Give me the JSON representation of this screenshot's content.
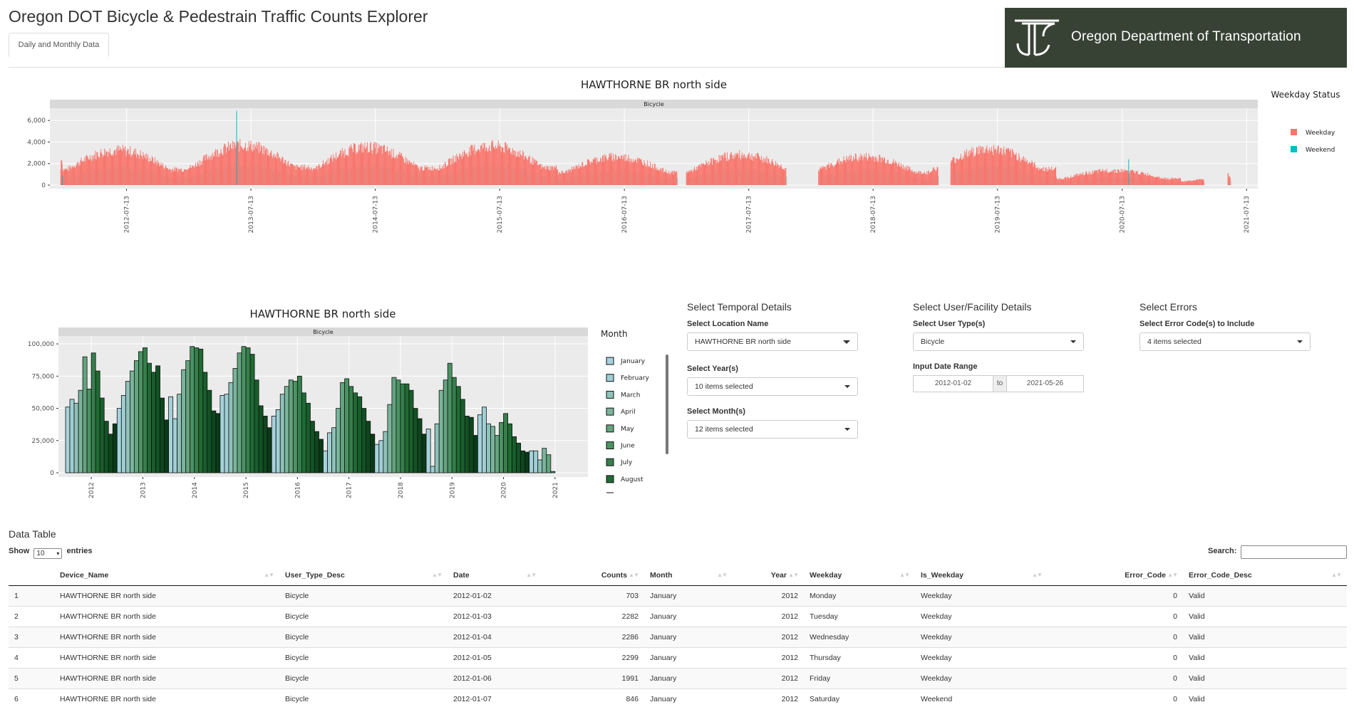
{
  "app": {
    "title": "Oregon DOT Bicycle & Pedestrain Traffic Counts Explorer",
    "tab_label": "Daily and Monthly Data",
    "org_name": "Oregon Department of Transportation",
    "brand_color": "#374234"
  },
  "chart_data": [
    {
      "type": "bar",
      "title": "HAWTHORNE BR north side",
      "facet_label": "Bicycle",
      "legend": {
        "title": "Weekday Status",
        "items": [
          "Weekday",
          "Weekend"
        ],
        "colors": [
          "#F8766D",
          "#00BFC4"
        ],
        "placement": "right"
      },
      "x_ticks": [
        "2012-07-13",
        "2013-07-13",
        "2014-07-13",
        "2015-07-13",
        "2016-07-13",
        "2017-07-13",
        "2018-07-13",
        "2019-07-13",
        "2020-07-13",
        "2021-07-13"
      ],
      "y_ticks": [
        "0",
        "2,000",
        "4,000",
        "6,000"
      ],
      "ylim": [
        0,
        7000
      ],
      "xlim": [
        "2012-01-02",
        "2021-07-13"
      ],
      "grid": true,
      "series": [
        {
          "name": "Weekday",
          "x": [
            "2012-01-02",
            "2012-01-03",
            "2012-01-04",
            "2012-01-05",
            "2012-01-06"
          ],
          "values": [
            703,
            2282,
            2286,
            2299,
            1991
          ]
        },
        {
          "name": "Weekend",
          "x": [
            "2012-01-07"
          ],
          "values": [
            846
          ]
        }
      ]
    },
    {
      "type": "bar",
      "title": "HAWTHORNE BR north side",
      "facet_label": "Bicycle",
      "legend": {
        "title": "Month",
        "items": [
          "January",
          "February",
          "March",
          "April",
          "May",
          "June",
          "July",
          "August"
        ],
        "colors": [
          "#a6d2dc",
          "#9fcfd4",
          "#8fc2b8",
          "#7ab59b",
          "#63a47e",
          "#4b9363",
          "#357f4b",
          "#1f6b33"
        ],
        "placement": "right"
      },
      "categories": [
        "2012",
        "2013",
        "2014",
        "2015",
        "2016",
        "2017",
        "2018",
        "2019",
        "2020",
        "2021"
      ],
      "y_ticks": [
        "0",
        "25,000",
        "50,000",
        "75,000",
        "100,000"
      ],
      "ylim": [
        0,
        105000
      ],
      "grid": true,
      "series": [
        {
          "name": "2012",
          "values": [
            51000,
            57000,
            54000,
            64000,
            90000,
            65000,
            93000,
            79000,
            58000,
            40000,
            30000,
            38000
          ]
        },
        {
          "name": "2013",
          "values": [
            50000,
            60000,
            71000,
            79000,
            87000,
            94000,
            97000,
            85000,
            78000,
            83000,
            58000,
            41000
          ]
        },
        {
          "name": "2014",
          "values": [
            59000,
            42000,
            61000,
            80000,
            87000,
            98000,
            97000,
            96000,
            78000,
            64000,
            48000,
            46000
          ]
        },
        {
          "name": "2015",
          "values": [
            60000,
            61000,
            70000,
            81000,
            93000,
            98000,
            97000,
            92000,
            72000,
            52000,
            44000,
            35000
          ]
        },
        {
          "name": "2016",
          "values": [
            44000,
            49000,
            61000,
            67000,
            72000,
            71000,
            75000,
            62000,
            54000,
            40000,
            32000,
            26000
          ]
        },
        {
          "name": "2017",
          "values": [
            17000,
            31000,
            35000,
            50000,
            70000,
            73000,
            67000,
            62000,
            59000,
            50000,
            40000,
            30000
          ]
        },
        {
          "name": "2018",
          "values": [
            22000,
            25000,
            32000,
            53000,
            74000,
            72000,
            69000,
            69000,
            64000,
            50000,
            42000,
            30000
          ]
        },
        {
          "name": "2019",
          "values": [
            34000,
            5000,
            38000,
            64000,
            72000,
            85000,
            74000,
            67000,
            57000,
            44000,
            43000,
            29000
          ]
        },
        {
          "name": "2020",
          "values": [
            45000,
            51000,
            38000,
            36000,
            29000,
            39000,
            46000,
            38000,
            28000,
            23000,
            17000,
            16000
          ]
        },
        {
          "name": "2021",
          "values": [
            17000,
            17000,
            10000,
            19000,
            14000,
            1000
          ]
        }
      ]
    }
  ],
  "controls": {
    "temporal": {
      "heading": "Select Temporal Details",
      "location_label": "Select Location Name",
      "location_value": "HAWTHORNE BR north side",
      "years_label": "Select Year(s)",
      "years_value": "10 items selected",
      "months_label": "Select Month(s)",
      "months_value": "12 items selected"
    },
    "user": {
      "heading": "Select User/Facility Details",
      "type_label": "Select User Type(s)",
      "type_value": "Bicycle",
      "date_label": "Input Date Range",
      "date_start": "2012-01-02",
      "date_to": "to",
      "date_end": "2021-05-26"
    },
    "errors": {
      "heading": "Select Errors",
      "codes_label": "Select Error Code(s) to Include",
      "codes_value": "4 items selected"
    }
  },
  "table": {
    "title": "Data Table",
    "show_label": "Show",
    "length_value": "10",
    "entries_label": "entries",
    "search_label": "Search:",
    "columns": [
      "",
      "Device_Name",
      "User_Type_Desc",
      "Date",
      "Counts",
      "Month",
      "Year",
      "Weekday",
      "Is_Weekday",
      "Error_Code",
      "Error_Code_Desc"
    ],
    "rows": [
      [
        "1",
        "HAWTHORNE BR north side",
        "Bicycle",
        "2012-01-02",
        "703",
        "January",
        "2012",
        "Monday",
        "Weekday",
        "0",
        "Valid"
      ],
      [
        "2",
        "HAWTHORNE BR north side",
        "Bicycle",
        "2012-01-03",
        "2282",
        "January",
        "2012",
        "Tuesday",
        "Weekday",
        "0",
        "Valid"
      ],
      [
        "3",
        "HAWTHORNE BR north side",
        "Bicycle",
        "2012-01-04",
        "2286",
        "January",
        "2012",
        "Wednesday",
        "Weekday",
        "0",
        "Valid"
      ],
      [
        "4",
        "HAWTHORNE BR north side",
        "Bicycle",
        "2012-01-05",
        "2299",
        "January",
        "2012",
        "Thursday",
        "Weekday",
        "0",
        "Valid"
      ],
      [
        "5",
        "HAWTHORNE BR north side",
        "Bicycle",
        "2012-01-06",
        "1991",
        "January",
        "2012",
        "Friday",
        "Weekday",
        "0",
        "Valid"
      ],
      [
        "6",
        "HAWTHORNE BR north side",
        "Bicycle",
        "2012-01-07",
        "846",
        "January",
        "2012",
        "Saturday",
        "Weekend",
        "0",
        "Valid"
      ]
    ]
  }
}
